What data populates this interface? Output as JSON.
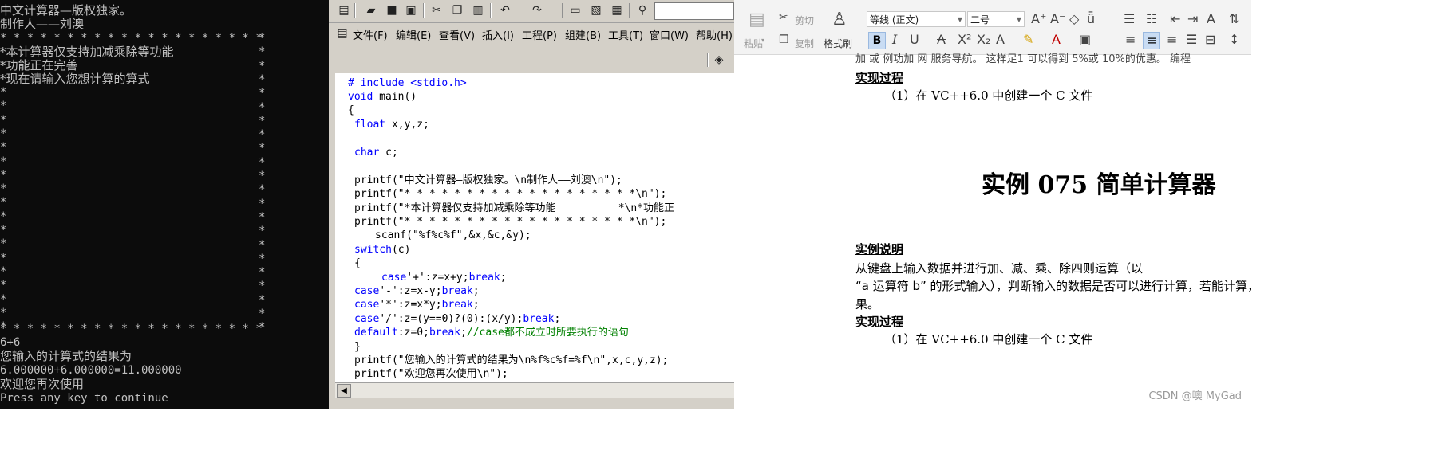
{
  "console": {
    "lines": [
      "中文计算器—版权独家。",
      "制作人——刘澳",
      "* * * * * * * * * * * * * * * * * * * *",
      "*本计算器仅支持加减乘除等功能",
      "*功能正在完善",
      "*现在请输入您想计算的算式",
      "* * * * * * * * * * * * * * * * * * * *",
      "6+6",
      "您输入的计算式的结果为",
      "6.000000+6.000000=11.000000",
      "欢迎您再次使用",
      "Press any key to continue"
    ],
    "star": "*"
  },
  "ide": {
    "menu": [
      "文件(F)",
      "编辑(E)",
      "查看(V)",
      "插入(I)",
      "工程(P)",
      "组建(B)",
      "工具(T)",
      "窗口(W)",
      "帮助(H)"
    ],
    "code": {
      "l1": "# include <stdio.h>",
      "l2a": "void",
      "l2b": " main()",
      "l3": "{",
      "l4a": "float",
      "l4b": " x,y,z;",
      "l5a": "char",
      "l5b": " c;",
      "l6": "printf(\"中文计算器—版权独家。\\n制作人——刘澳\\n\");",
      "l7": "printf(\"* * * * * * * * * * * * * * * * * * *\\n\");",
      "l8": "printf(\"*本计算器仅支持加减乘除等功能          *\\n*功能正",
      "l9": "printf(\"* * * * * * * * * * * * * * * * * * *\\n\");",
      "l10": "scanf(\"%f%c%f\",&x,&c,&y);",
      "l11a": "switch",
      "l11b": "(c)",
      "l12": "{",
      "l13a": "case",
      "l13b": "'+':z=x+y;",
      "l13c": "break",
      "l13d": ";",
      "l14a": "case",
      "l14b": "'-':z=x-y;",
      "l14c": "break",
      "l14d": ";",
      "l15a": "case",
      "l15b": "'*':z=x*y;",
      "l15c": "break",
      "l15d": ";",
      "l16a": "case",
      "l16b": "'/':z=(y==0)?(0):(x/y);",
      "l16c": "break",
      "l16d": ";",
      "l17a": "default",
      "l17b": ":z=0;",
      "l17c": "break",
      "l17d": ";",
      "l17e": "//case都不成立时所要执行的语句",
      "l18": "}",
      "l19": "printf(\"您输入的计算式的结果为\\n%f%c%f=%f\\n\",x,c,y,z);",
      "l20": "printf(\"欢迎您再次使用\\n\");"
    }
  },
  "word": {
    "ribbon": {
      "paste": "粘贴",
      "cut": "剪切",
      "copy": "复制",
      "format_painter": "格式刷",
      "font_name": "等线 (正文)",
      "font_size": "二号"
    },
    "doc": {
      "top_partial": "加 或 例功加 网 服务导航。 这样足1 可以得到 5%或 10%的优惠。 编程",
      "h_process1": "实现过程",
      "step1": "（1）在 VC++6.0 中创建一个 C 文件",
      "title": "实例 075 简单计算器",
      "h_explain": "实例说明",
      "para1": "从键盘上输入数据并进行加、减、乘、除四则运算（以",
      "para2": "“a 运算符 b” 的形式输入），判断输入的数据是否可以进行计算，若能计算，",
      "para3": "果。",
      "h_process2": "实现过程",
      "step2": "（1）在 VC++6.0 中创建一个 C 文件"
    },
    "watermark": "CSDN @噢   MyGad"
  }
}
